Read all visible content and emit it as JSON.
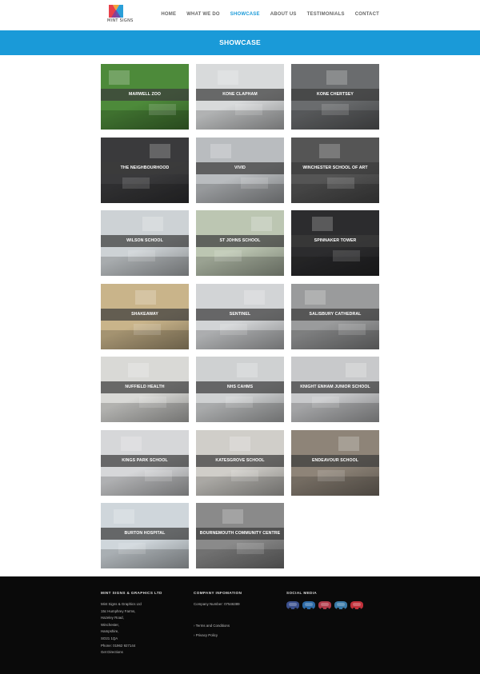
{
  "brand": {
    "name": "MINT SIGNS"
  },
  "nav": [
    {
      "label": "HOME",
      "active": false
    },
    {
      "label": "WHAT WE DO",
      "active": false
    },
    {
      "label": "SHOWCASE",
      "active": true
    },
    {
      "label": "ABOUT US",
      "active": false
    },
    {
      "label": "TESTIMONIALS",
      "active": false
    },
    {
      "label": "CONTACT",
      "active": false
    }
  ],
  "banner": {
    "title": "SHOWCASE"
  },
  "showcase": [
    {
      "label": "MARWELL ZOO",
      "icon": "zoo-photo",
      "bg": "#4d8a3a"
    },
    {
      "label": "KONE CLAPHAM",
      "icon": "office-wall-photo",
      "bg": "#d8dadb"
    },
    {
      "label": "KONE CHERTSEY",
      "icon": "corridor-photo",
      "bg": "#6a6c6e"
    },
    {
      "label": "THE NEIGHBOURHOOD",
      "icon": "sign-photo",
      "bg": "#3a3a3c"
    },
    {
      "label": "VIVID",
      "icon": "reception-photo",
      "bg": "#b9bcbf"
    },
    {
      "label": "WINCHESTER SCHOOL OF ART",
      "icon": "art-wall-photo",
      "bg": "#555"
    },
    {
      "label": "WILSON SCHOOL",
      "icon": "school-photo",
      "bg": "#cdd2d5"
    },
    {
      "label": "ST JOHNS SCHOOL",
      "icon": "school-photo",
      "bg": "#bcc6b2"
    },
    {
      "label": "SPINNAKER TOWER",
      "icon": "tower-photo",
      "bg": "#2c2c2e"
    },
    {
      "label": "SHAKEAWAY",
      "icon": "shop-photo",
      "bg": "#c9b48a"
    },
    {
      "label": "SENTINEL",
      "icon": "office-photo",
      "bg": "#d2d4d6"
    },
    {
      "label": "SALISBURY CATHEDRAL",
      "icon": "cathedral-photo",
      "bg": "#9a9b9c"
    },
    {
      "label": "NUFFIELD HEALTH",
      "icon": "gym-photo",
      "bg": "#d9d9d6"
    },
    {
      "label": "NHS CAHMS",
      "icon": "canvas-photo",
      "bg": "#cfd1d2"
    },
    {
      "label": "KNIGHT ENHAM JUNIOR SCHOOL",
      "icon": "school-photo",
      "bg": "#c8c9cb"
    },
    {
      "label": "KINGS PARK SCHOOL",
      "icon": "tree-wall-photo",
      "bg": "#d6d7d9"
    },
    {
      "label": "KATESGROVE SCHOOL",
      "icon": "crest-photo",
      "bg": "#d0cec9"
    },
    {
      "label": "ENDEAVOUR SCHOOL",
      "icon": "hall-photo",
      "bg": "#8e8478"
    },
    {
      "label": "BURTON HOSPITAL",
      "icon": "hospital-photo",
      "bg": "#cfd6db"
    },
    {
      "label": "BOURNEMOUTH COMMUNITY CENTRE",
      "icon": "mural-photo",
      "bg": "#8a8a8a"
    }
  ],
  "footer": {
    "company_heading": "MINT SIGNS & GRAPHICS LTD",
    "address": [
      "Mint Signs & Graphics Ltd",
      "15c Humphrey Farms,",
      "Hazeley Road,",
      "Winchester,",
      "Hampshire,",
      "SO21 1QA",
      "Phone: 01962 927144",
      "Get Directions"
    ],
    "info_heading": "COMPANY INFOMATION",
    "company_number": "Company Number: 07546389",
    "links": [
      "Terms and Conditions",
      "Privacy Policy"
    ],
    "social_heading": "SOCIAL MEDIA",
    "social": [
      {
        "icon": "van-icon",
        "color": "#3a4f8c"
      },
      {
        "icon": "van-icon",
        "color": "#2d6aa6"
      },
      {
        "icon": "van-icon",
        "color": "#b03b4a"
      },
      {
        "icon": "van-icon",
        "color": "#3a7aa8"
      },
      {
        "icon": "van-icon",
        "color": "#c0303a"
      }
    ]
  }
}
